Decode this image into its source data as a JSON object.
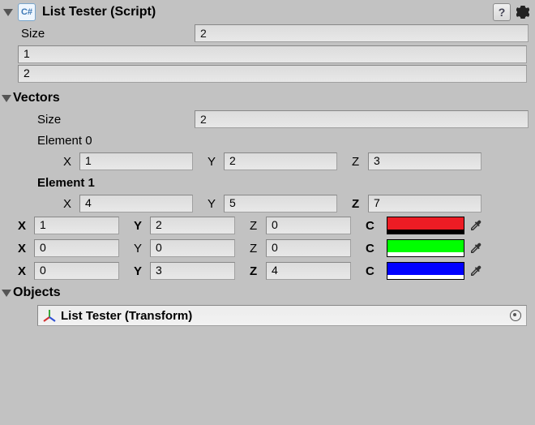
{
  "header": {
    "title": "List Tester (Script)"
  },
  "integers": {
    "size_label": "Size",
    "size_value": "2",
    "items": [
      "1",
      "2"
    ]
  },
  "vectors": {
    "title": "Vectors",
    "size_label": "Size",
    "size_value": "2",
    "elements": [
      {
        "label": "Element 0",
        "x_label": "X",
        "x": "1",
        "y_label": "Y",
        "y": "2",
        "z_label": "Z",
        "z": "3"
      },
      {
        "label": "Element 1",
        "x_label": "X",
        "x": "4",
        "y_label": "Y",
        "y": "5",
        "z_label": "Z",
        "z": "7"
      }
    ]
  },
  "colors": {
    "rows": [
      {
        "x_label": "X",
        "x": "1",
        "y_label": "Y",
        "y": "2",
        "z_label": "Z",
        "z": "0",
        "c_label": "C",
        "swatch": "#ed1c24",
        "alpha": 0
      },
      {
        "x_label": "X",
        "x": "0",
        "y_label": "Y",
        "y": "0",
        "z_label": "Z",
        "z": "0",
        "c_label": "C",
        "swatch": "#00ff00",
        "alpha": 100
      },
      {
        "x_label": "X",
        "x": "0",
        "y_label": "Y",
        "y": "3",
        "z_label": "Z",
        "z": "4",
        "c_label": "C",
        "swatch": "#0000ff",
        "alpha": 100
      }
    ]
  },
  "objects": {
    "title": "Objects",
    "entry": "List Tester (Transform)"
  }
}
